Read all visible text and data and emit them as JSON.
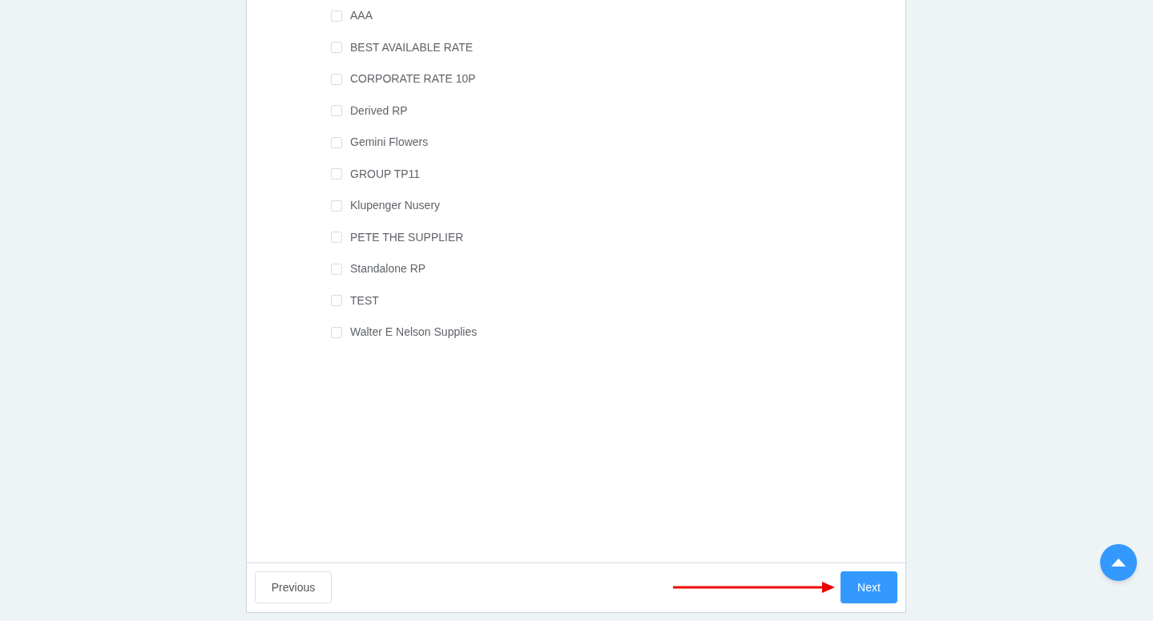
{
  "options": [
    {
      "label": "AAA",
      "checked": false
    },
    {
      "label": "BEST AVAILABLE RATE",
      "checked": false
    },
    {
      "label": "CORPORATE RATE 10P",
      "checked": false
    },
    {
      "label": "Derived RP",
      "checked": false
    },
    {
      "label": "Gemini Flowers",
      "checked": false
    },
    {
      "label": "GROUP TP11",
      "checked": false
    },
    {
      "label": "Klupenger Nusery",
      "checked": false
    },
    {
      "label": "PETE THE SUPPLIER",
      "checked": false
    },
    {
      "label": "Standalone RP",
      "checked": false
    },
    {
      "label": "TEST",
      "checked": false
    },
    {
      "label": "Walter E Nelson Supplies",
      "checked": false
    }
  ],
  "buttons": [
    {
      "label": "Previous",
      "kind": "secondary"
    },
    {
      "label": "Next",
      "kind": "primary"
    }
  ]
}
